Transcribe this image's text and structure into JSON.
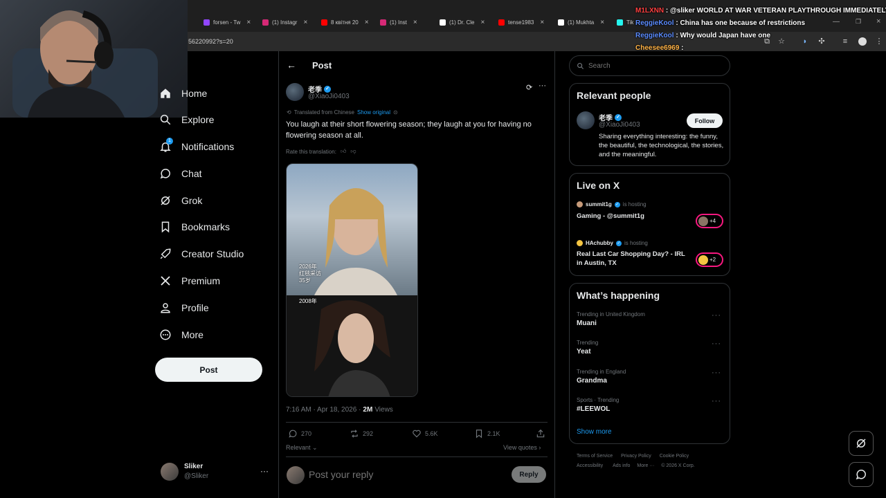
{
  "browser": {
    "tabs": [
      {
        "label": "forsen - Tw",
        "color": "#9146ff"
      },
      {
        "label": "(1) Instagr",
        "color": "#d62976"
      },
      {
        "label": "8 квітня 20",
        "color": "#ff0000"
      },
      {
        "label": "(1) Inst",
        "color": "#d62976"
      },
      {
        "label": "(1) Dr. Cle",
        "color": "#ffffff"
      },
      {
        "label": "tense1983",
        "color": "#ff0000"
      },
      {
        "label": "(1) Mukhta",
        "color": "#ffffff"
      },
      {
        "label": "Tik",
        "color": "#25f4ee"
      }
    ],
    "url_fragment": "56220992?s=20"
  },
  "chat_overlay": [
    {
      "name": "M1LXNN",
      "message": ": @sliker WORLD AT WAR VETERAN PLAYTHROUGH IMMEDIATELY",
      "name_color": "red"
    },
    {
      "name": "ReggieKool",
      "message": ": China has one because of restrictions",
      "name_color": "blue"
    },
    {
      "name": "ReggieKool",
      "message": ": Why would Japan have one",
      "name_color": "blue"
    },
    {
      "name": "Cheesee6969",
      "message": ":",
      "name_color": "gold"
    }
  ],
  "nav": {
    "items": [
      {
        "label": "Home",
        "icon": "home-icon"
      },
      {
        "label": "Explore",
        "icon": "search-icon"
      },
      {
        "label": "Notifications",
        "icon": "bell-icon",
        "badge": "1"
      },
      {
        "label": "Chat",
        "icon": "chat-icon"
      },
      {
        "label": "Grok",
        "icon": "grok-icon"
      },
      {
        "label": "Bookmarks",
        "icon": "bookmark-icon"
      },
      {
        "label": "Creator Studio",
        "icon": "rocket-icon"
      },
      {
        "label": "Premium",
        "icon": "x-logo-icon"
      },
      {
        "label": "Profile",
        "icon": "person-icon"
      },
      {
        "label": "More",
        "icon": "more-circle-icon"
      }
    ],
    "post_button": "Post",
    "account": {
      "name": "Sliker",
      "handle": "@Sliker"
    }
  },
  "post": {
    "header_title": "Post",
    "author_name": "老季",
    "author_handle": "@XiaoJi0403",
    "translated_from": "Translated from Chinese",
    "show_original": "Show original",
    "text": "You laugh at their short flowering season; they laugh at you for having no flowering season at all.",
    "rate_translation": "Rate this translation:",
    "image_caption_top": "2026年\n红毯采访\n35岁",
    "image_caption_bottom": "2008年\n",
    "timestamp": "7:16 AM · Apr 18, 2026 ·",
    "views_count": "2M",
    "views_label": "Views",
    "stats": {
      "replies": "270",
      "reposts": "292",
      "likes": "5.6K",
      "bookmarks": "2.1K"
    },
    "sort_label": "Relevant",
    "view_quotes": "View quotes",
    "reply_placeholder": "Post your reply",
    "reply_button": "Reply"
  },
  "right": {
    "search_placeholder": "Search",
    "relevant_people": {
      "title": "Relevant people",
      "name": "老季",
      "handle": "@XiaoJi0403",
      "follow_label": "Follow",
      "bio": "Sharing everything interesting: the funny, the beautiful, the technological, the stories, and the meaningful."
    },
    "live": {
      "title": "Live on X",
      "items": [
        {
          "host": "summit1g",
          "status": "is hosting",
          "title": "Gaming - @summit1g",
          "extra": "+4"
        },
        {
          "host": "HAchubby",
          "status": "is hosting",
          "title": "Real Last Car Shopping Day? - IRL in Austin, TX",
          "extra": "+2"
        }
      ]
    },
    "happening": {
      "title": "What’s happening",
      "trends": [
        {
          "context": "Trending in United Kingdom",
          "name": "Muani"
        },
        {
          "context": "Trending",
          "name": "Yeat"
        },
        {
          "context": "Trending in England",
          "name": "Grandma"
        },
        {
          "context": "Sports · Trending",
          "name": "#LEEWOL"
        }
      ],
      "show_more": "Show more"
    },
    "footer": [
      "Terms of Service",
      "Privacy Policy",
      "Cookie Policy",
      "Accessibility",
      "Ads info",
      "More ···",
      "© 2026 X Corp."
    ]
  },
  "colors": {
    "accent": "#1d9bf0",
    "background": "#000000",
    "border": "#2f3336",
    "muted_text": "#71767b"
  }
}
